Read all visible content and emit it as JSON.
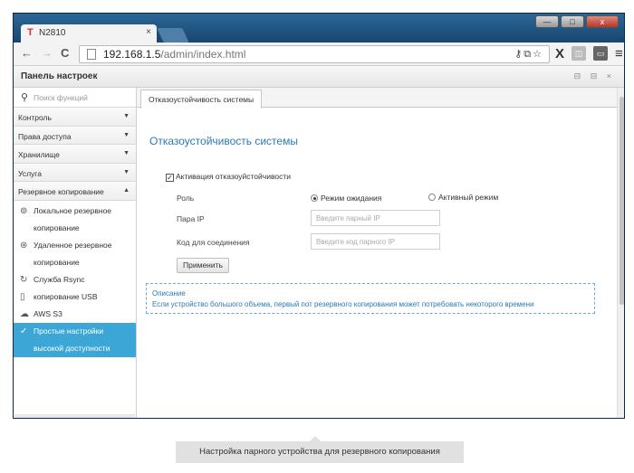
{
  "browser": {
    "tab_favicon": "T",
    "tab_title": "N2810",
    "tab_close": "×",
    "url_host": "192.168.1.5",
    "url_path": "/admin/index.html",
    "nav": {
      "back": "←",
      "forward": "→",
      "reload": "C"
    },
    "window_controls": {
      "minimize": "—",
      "maximize": "□",
      "close": "x"
    }
  },
  "app": {
    "header_title": "Панель настроек",
    "header_icons": "⊟ ⊟ ×"
  },
  "sidebar": {
    "search_placeholder": "Поиск функций",
    "menus": [
      {
        "label": "Контроль",
        "arrow": "▼"
      },
      {
        "label": "Права доступа",
        "arrow": "▼"
      },
      {
        "label": "Хранилище",
        "arrow": "▼"
      },
      {
        "label": "Услуга",
        "arrow": "▼"
      },
      {
        "label": "Резервное копирование",
        "arrow": "▲"
      }
    ],
    "sub_items": [
      {
        "line1": "Локальное резервное",
        "line2": "копирование",
        "icon": "local-backup-icon"
      },
      {
        "line1": "Удаленное резервное",
        "line2": "копирование",
        "icon": "remote-backup-icon"
      },
      {
        "line1": "Служба Rsync",
        "icon": "rsync-icon"
      },
      {
        "line1": "копирование USB",
        "icon": "usb-icon"
      },
      {
        "line1": "AWS S3",
        "icon": "cloud-icon"
      },
      {
        "line1": "Простые настройки",
        "line2": "высокой доступности",
        "icon": "ha-icon",
        "active": true
      }
    ]
  },
  "content": {
    "tab_label": "Отказоустойчивость системы",
    "section_title": "Отказоустойчивость системы",
    "activation_label": "Активация отказоуйстойчивости",
    "activation_checked": true,
    "role_label": "Роль",
    "role_options": [
      "Режим ожидания",
      "Активный режим"
    ],
    "role_selected": "Режим ожидания",
    "pair_ip_label": "Пара IP",
    "pair_ip_placeholder": "Введите парный IP",
    "connection_code_label": "Код для соединения",
    "connection_code_placeholder": "Введите код парного IP",
    "apply_label": "Применить",
    "description_title": "Описание",
    "description_text": "Если устройство большого объема, первый пот резервного копирования может потребовать некоторого времени"
  },
  "caption": "Настройка парного устройства для резервного копирования",
  "colors": {
    "accent": "#2a7ab3",
    "active_item": "#3ca7d6",
    "window_frame": "#0f3d6b"
  }
}
